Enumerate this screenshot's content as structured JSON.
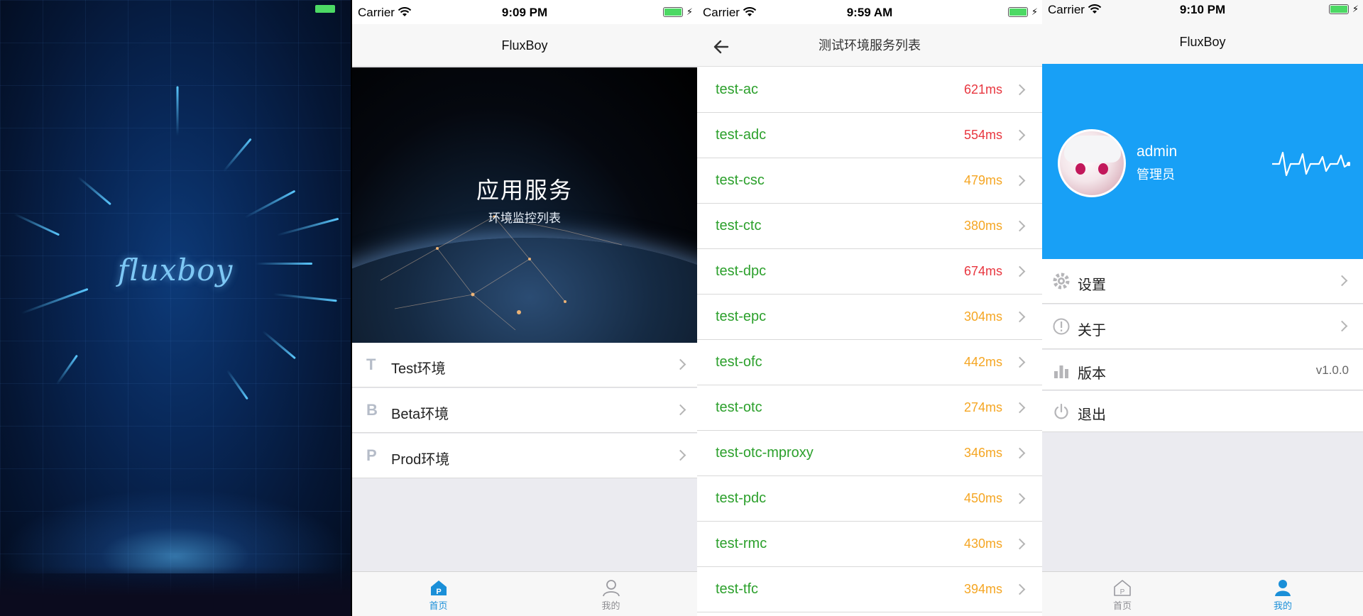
{
  "splash": {
    "logo": "fluxboy"
  },
  "home": {
    "status": {
      "carrier": "Carrier",
      "time": "9:09 PM"
    },
    "nav_title": "FluxBoy",
    "banner": {
      "title": "应用服务",
      "subtitle": "环境监控列表"
    },
    "envs": [
      {
        "letter": "T",
        "label": "Test环境"
      },
      {
        "letter": "B",
        "label": "Beta环境"
      },
      {
        "letter": "P",
        "label": "Prod环境"
      }
    ],
    "tabs": [
      {
        "label": "首页",
        "icon": "home-icon",
        "active": true
      },
      {
        "label": "我的",
        "icon": "person-icon",
        "active": false
      }
    ]
  },
  "services": {
    "status": {
      "carrier": "Carrier",
      "time": "9:59 AM"
    },
    "nav_title": "测试环境服务列表",
    "items": [
      {
        "name": "test-ac",
        "latency": "621ms",
        "level": "high"
      },
      {
        "name": "test-adc",
        "latency": "554ms",
        "level": "high"
      },
      {
        "name": "test-csc",
        "latency": "479ms",
        "level": "medium"
      },
      {
        "name": "test-ctc",
        "latency": "380ms",
        "level": "medium"
      },
      {
        "name": "test-dpc",
        "latency": "674ms",
        "level": "high"
      },
      {
        "name": "test-epc",
        "latency": "304ms",
        "level": "medium"
      },
      {
        "name": "test-ofc",
        "latency": "442ms",
        "level": "medium"
      },
      {
        "name": "test-otc",
        "latency": "274ms",
        "level": "medium"
      },
      {
        "name": "test-otc-mproxy",
        "latency": "346ms",
        "level": "medium"
      },
      {
        "name": "test-pdc",
        "latency": "450ms",
        "level": "medium"
      },
      {
        "name": "test-rmc",
        "latency": "430ms",
        "level": "medium"
      },
      {
        "name": "test-tfc",
        "latency": "394ms",
        "level": "medium"
      }
    ]
  },
  "profile": {
    "status": {
      "carrier": "Carrier",
      "time": "9:10 PM"
    },
    "nav_title": "FluxBoy",
    "user": {
      "name": "admin",
      "role": "管理员"
    },
    "menu": [
      {
        "icon": "gear-icon",
        "label": "设置",
        "value": "",
        "chevron": true
      },
      {
        "icon": "info-icon",
        "label": "关于",
        "value": "",
        "chevron": true
      },
      {
        "icon": "bar-chart-icon",
        "label": "版本",
        "value": "v1.0.0",
        "chevron": false
      },
      {
        "icon": "power-icon",
        "label": "退出",
        "value": "",
        "chevron": false
      }
    ],
    "tabs": [
      {
        "label": "首页",
        "icon": "home-icon",
        "active": false
      },
      {
        "label": "我的",
        "icon": "person-icon",
        "active": true
      }
    ]
  },
  "colors": {
    "accent": "#1a9ff2",
    "tab_active": "#1a8fd8",
    "tab_inactive": "#8e8e93",
    "latency_high": "#e8363f",
    "latency_medium": "#f5a623",
    "service_name": "#2ca02c"
  }
}
